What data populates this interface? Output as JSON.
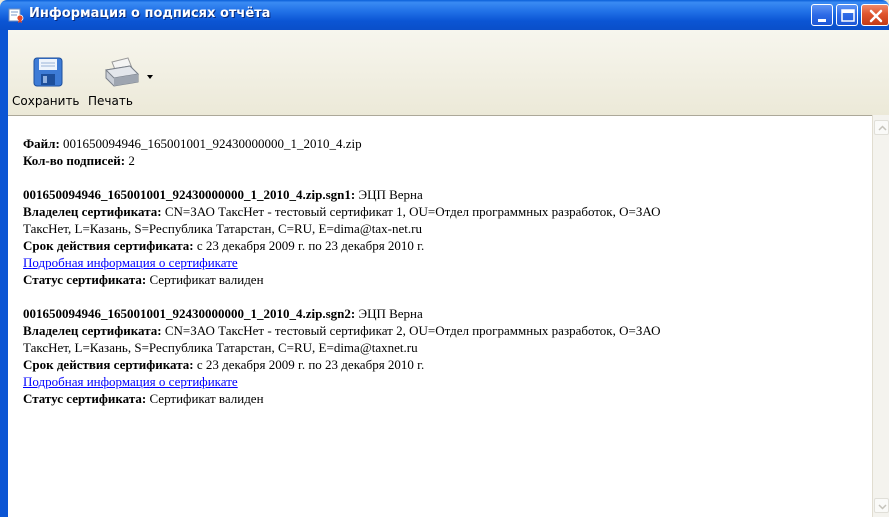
{
  "window": {
    "title": "Информация о подписях отчёта"
  },
  "toolbar": {
    "save_label": "Сохранить",
    "print_label": "Печать"
  },
  "document": {
    "file_label": "Файл:",
    "file_value": " 001650094946_165001001_92430000000_1_2010_4.zip",
    "count_label": "Кол-во подписей:",
    "count_value": " 2",
    "signatures": [
      {
        "name": "001650094946_165001001_92430000000_1_2010_4.zip.sgn1:",
        "provider": " ЭЦП Верна",
        "owner_label": "Владелец сертификата:",
        "owner_line1": " CN=ЗАО ТаксНет - тестовый сертификат 1, OU=Отдел программных разработок, O=ЗАО",
        "owner_line2": "ТаксНет, L=Казань, S=Республика Татарстан, C=RU, E=dima@tax-net.ru",
        "validity_label": "Срок действия сертификата:",
        "validity_value": " с 23 декабря 2009 г. по 23 декабря 2010 г.",
        "details_link": "Подробная информация о сертификате",
        "status_label": "Статус сертификата:",
        "status_value": " Сертификат валиден"
      },
      {
        "name": "001650094946_165001001_92430000000_1_2010_4.zip.sgn2:",
        "provider": " ЭЦП Верна",
        "owner_label": "Владелец сертификата:",
        "owner_line1": " CN=ЗАО ТаксНет - тестовый сертификат 2, OU=Отдел программных разработок, O=ЗАО",
        "owner_line2": "ТаксНет, L=Казань, S=Республика Татарстан, C=RU, E=dima@taxnet.ru",
        "validity_label": "Срок действия сертификата:",
        "validity_value": " с 23 декабря 2009 г. по 23 декабря 2010 г.",
        "details_link": "Подробная информация о сертификате",
        "status_label": "Статус сертификата:",
        "status_value": " Сертификат валиден"
      }
    ]
  },
  "icons": {
    "title": "certificate-icon",
    "save": "floppy-disk-icon",
    "print": "printer-icon",
    "print_menu": "dropdown-arrow-icon",
    "minimize": "minimize-icon",
    "maximize": "maximize-icon",
    "close": "close-icon",
    "scroll_up": "scroll-up-arrow-icon",
    "scroll_down": "scroll-down-arrow-icon"
  },
  "colors": {
    "titlebar": "#0b55d4",
    "link": "#0000ff",
    "close_button": "#e0552e"
  }
}
